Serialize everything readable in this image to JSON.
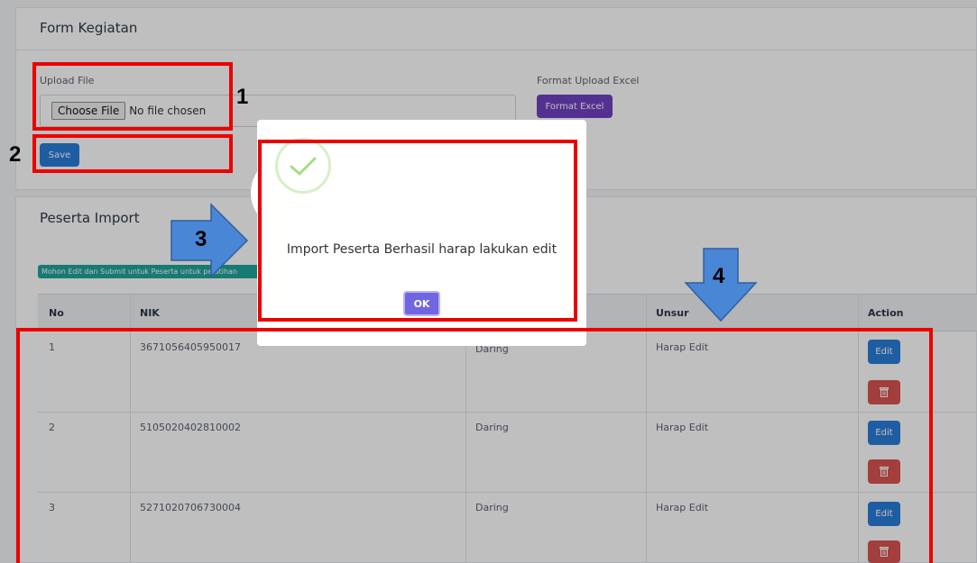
{
  "form": {
    "title": "Form Kegiatan",
    "upload_label": "Upload File",
    "choose_file": "Choose File",
    "no_file": "No file chosen",
    "format_label": "Format Upload Excel",
    "format_button": "Format Excel",
    "save_button": "Save"
  },
  "peserta": {
    "title": "Peserta Import",
    "notice": "Mohon Edit dan Submit untuk Peserta untuk pelatihan",
    "columns": [
      "No",
      "NIK",
      "Unsur",
      "Action"
    ],
    "rows": [
      {
        "no": "1",
        "nik": "3671056405950017",
        "mode": "Daring",
        "unsur": "Harap Edit"
      },
      {
        "no": "2",
        "nik": "5105020402810002",
        "mode": "Daring",
        "unsur": "Harap Edit"
      },
      {
        "no": "3",
        "nik": "5271020706730004",
        "mode": "Daring",
        "unsur": "Harap Edit"
      }
    ],
    "edit_label": "Edit"
  },
  "modal": {
    "message": "Import Peserta Berhasil harap lakukan edit",
    "ok_label": "OK"
  },
  "annotations": {
    "n1": "1",
    "n2": "2",
    "n3": "3",
    "n4": "4"
  },
  "colors": {
    "highlight": "#ec0000",
    "arrow": "#4a86d6",
    "primary": "#2a7dd8",
    "purple": "#6f42c1",
    "danger": "#d9534f",
    "confirm": "#7066e0"
  }
}
